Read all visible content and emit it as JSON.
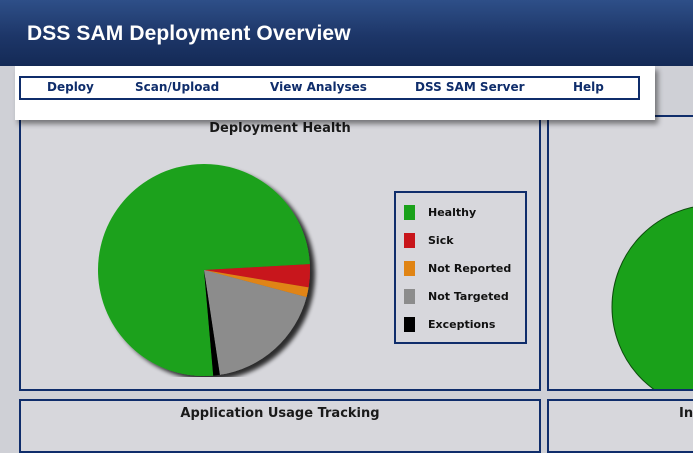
{
  "header": {
    "title": "DSS SAM Deployment Overview"
  },
  "menu": {
    "items": [
      "Deploy",
      "Scan/Upload",
      "View Analyses",
      "DSS SAM Server",
      "Help"
    ]
  },
  "panels": {
    "deployment_health": {
      "title": "Deployment Health"
    },
    "usage_tracking": {
      "title": "Application Usage Tracking"
    },
    "right_bottom": {
      "title": "In"
    }
  },
  "legend": {
    "items": [
      {
        "label": "Healthy",
        "color": "#1aa11a"
      },
      {
        "label": "Sick",
        "color": "#c8151b"
      },
      {
        "label": "Not Reported",
        "color": "#e08414"
      },
      {
        "label": "Not Targeted",
        "color": "#8c8c8c"
      },
      {
        "label": "Exceptions",
        "color": "#000000"
      }
    ]
  },
  "chart_data": {
    "type": "pie",
    "title": "Deployment Health",
    "categories": [
      "Healthy",
      "Sick",
      "Not Reported",
      "Not Targeted",
      "Exceptions"
    ],
    "values": [
      75.5,
      3.5,
      1.5,
      18.5,
      1.0
    ],
    "colors": [
      "#1aa11a",
      "#c8151b",
      "#e08414",
      "#8c8c8c",
      "#000000"
    ]
  }
}
